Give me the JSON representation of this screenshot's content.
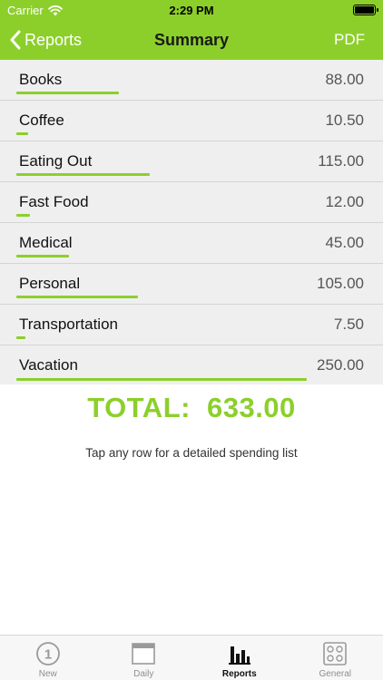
{
  "status": {
    "carrier": "Carrier",
    "time": "2:29 PM"
  },
  "nav": {
    "back_label": "Reports",
    "title": "Summary",
    "pdf_label": "PDF"
  },
  "categories": [
    {
      "label": "Books",
      "value": "88.00",
      "amount": 88.0
    },
    {
      "label": "Coffee",
      "value": "10.50",
      "amount": 10.5
    },
    {
      "label": "Eating Out",
      "value": "115.00",
      "amount": 115.0
    },
    {
      "label": "Fast Food",
      "value": "12.00",
      "amount": 12.0
    },
    {
      "label": "Medical",
      "value": "45.00",
      "amount": 45.0
    },
    {
      "label": "Personal",
      "value": "105.00",
      "amount": 105.0
    },
    {
      "label": "Transportation",
      "value": "7.50",
      "amount": 7.5
    },
    {
      "label": "Vacation",
      "value": "250.00",
      "amount": 250.0
    }
  ],
  "total": {
    "label": "TOTAL:",
    "value": "633.00"
  },
  "hint": "Tap any row for a detailed spending list",
  "tabs": [
    {
      "label": "New",
      "icon": "number-one-circle-icon",
      "active": false
    },
    {
      "label": "Daily",
      "icon": "calendar-page-icon",
      "active": false
    },
    {
      "label": "Reports",
      "icon": "bar-chart-icon",
      "active": true
    },
    {
      "label": "General",
      "icon": "settings-grid-icon",
      "active": false
    }
  ],
  "colors": {
    "accent": "#8ccf2b",
    "list_bg": "#efefef",
    "tab_inactive": "#8e8e8e"
  }
}
